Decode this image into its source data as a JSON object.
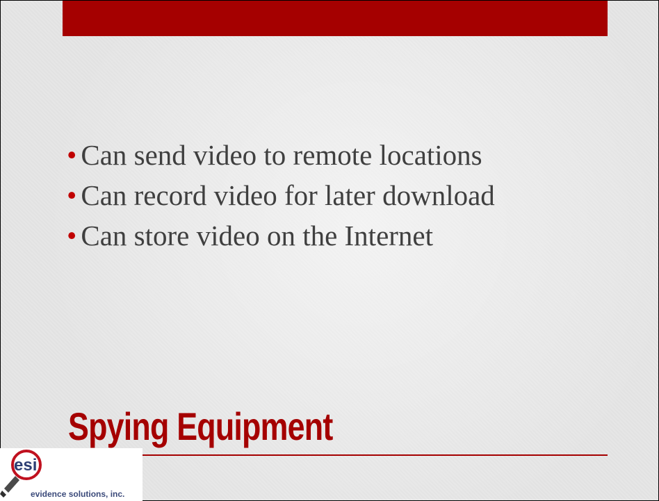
{
  "slide": {
    "title": "Spying Equipment",
    "bullets": [
      "Can send video to remote locations",
      "Can record video for later download",
      "Can store video on the Internet"
    ],
    "bullet_glyph": "•"
  },
  "logo": {
    "mark_text": "esi",
    "company_name": "evidence solutions, inc."
  },
  "colors": {
    "accent": "#a50000",
    "bullet": "#c00000",
    "body_text": "#3f3f3f",
    "background": "#e6e6e6"
  }
}
